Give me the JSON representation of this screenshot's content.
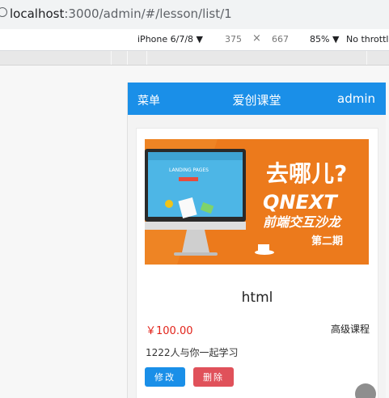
{
  "browser": {
    "url_host": "localhost",
    "url_path": ":3000/admin/#/lesson/list/1"
  },
  "devtools": {
    "device": "iPhone 6/7/8 ▼",
    "width": "375",
    "times": "×",
    "height": "667",
    "zoom": "85% ▼",
    "throttle": "No throttl"
  },
  "app": {
    "menu_label": "菜单",
    "title": "爱创课堂",
    "user": "admin"
  },
  "lesson": {
    "banner_text": {
      "where": "去哪儿?",
      "brand": "QNEXT",
      "sub": "前端交互沙龙",
      "issue": "第二期",
      "screen": "LANDING PAGES"
    },
    "title": "html",
    "price": "￥100.00",
    "level": "高级课程",
    "learners": "1222人与你一起学习",
    "edit_label": "修改",
    "delete_label": "删除"
  }
}
